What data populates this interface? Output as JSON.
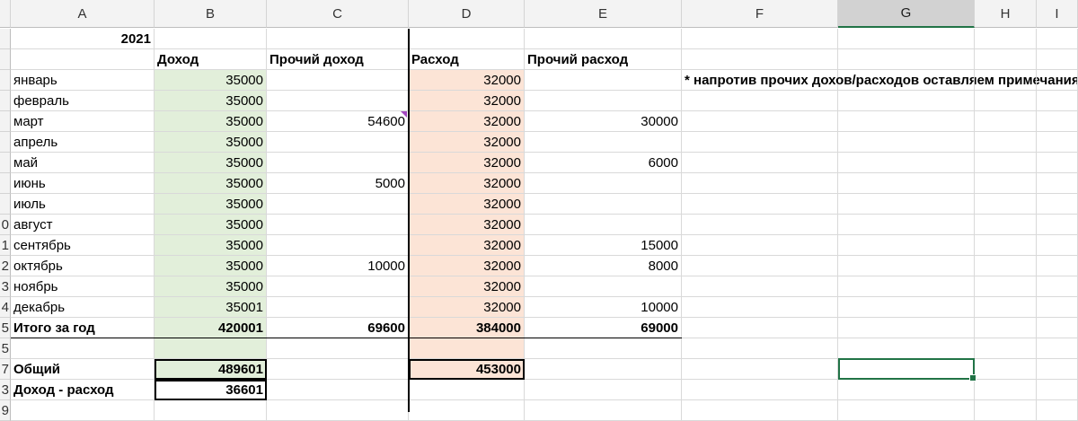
{
  "columns": [
    "A",
    "B",
    "C",
    "D",
    "E",
    "F",
    "G",
    "H",
    "I"
  ],
  "selected_column": "G",
  "row_numbers": [
    "",
    "",
    "",
    "",
    "",
    "",
    "",
    "",
    "",
    "0",
    "1",
    "2",
    "3",
    "4",
    "5",
    "5",
    "7",
    "3",
    "9"
  ],
  "year": "2021",
  "headers": {
    "income": "Доход",
    "other_income": "Прочий доход",
    "expense": "Расход",
    "other_expense": "Прочий расход"
  },
  "note": "* напротив прочих дохов/расходов оставляем примечания",
  "months": [
    {
      "name": "январь",
      "income": "35000",
      "other_income": "",
      "expense": "32000",
      "other_expense": ""
    },
    {
      "name": "февраль",
      "income": "35000",
      "other_income": "",
      "expense": "32000",
      "other_expense": ""
    },
    {
      "name": "март",
      "income": "35000",
      "other_income": "54600",
      "expense": "32000",
      "other_expense": "30000"
    },
    {
      "name": "апрель",
      "income": "35000",
      "other_income": "",
      "expense": "32000",
      "other_expense": ""
    },
    {
      "name": "май",
      "income": "35000",
      "other_income": "",
      "expense": "32000",
      "other_expense": "6000"
    },
    {
      "name": "июнь",
      "income": "35000",
      "other_income": "5000",
      "expense": "32000",
      "other_expense": ""
    },
    {
      "name": "июль",
      "income": "35000",
      "other_income": "",
      "expense": "32000",
      "other_expense": ""
    },
    {
      "name": "август",
      "income": "35000",
      "other_income": "",
      "expense": "32000",
      "other_expense": ""
    },
    {
      "name": "сентябрь",
      "income": "35000",
      "other_income": "",
      "expense": "32000",
      "other_expense": "15000"
    },
    {
      "name": "октябрь",
      "income": "35000",
      "other_income": "10000",
      "expense": "32000",
      "other_expense": "8000"
    },
    {
      "name": "ноябрь",
      "income": "35000",
      "other_income": "",
      "expense": "32000",
      "other_expense": ""
    },
    {
      "name": "декабрь",
      "income": "35001",
      "other_income": "",
      "expense": "32000",
      "other_expense": "10000"
    }
  ],
  "totals": {
    "label": "Итого за год",
    "income": "420001",
    "other_income": "69600",
    "expense": "384000",
    "other_expense": "69000"
  },
  "general": {
    "label": "Общий",
    "income": "489601",
    "expense": "453000"
  },
  "balance": {
    "label": "Доход - расход",
    "value": "36601"
  },
  "colors": {
    "income_fill": "#e2efda",
    "expense_fill": "#fce4d6",
    "active_cell_border": "#217346",
    "comment_marker": "#a347bf"
  }
}
